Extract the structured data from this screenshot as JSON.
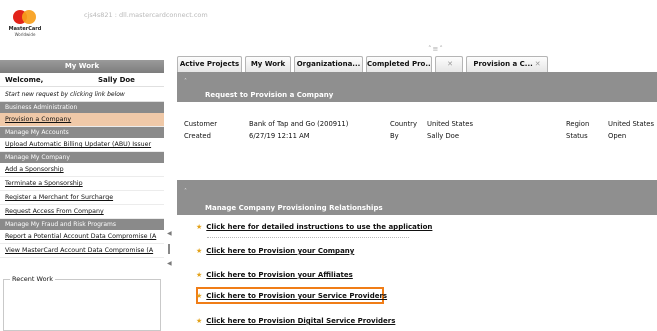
{
  "header": {
    "logo_text": "MasterCard",
    "logo_sub": "Worldwide",
    "host": "cjs4s821 : dll.mastercardconnect.com"
  },
  "sidebar": {
    "title": "My Work",
    "welcome_label": "Welcome,",
    "user_name": "Sally Doe",
    "hint": "Start new request by clicking link below",
    "sections": [
      {
        "title": "Business Administration",
        "items": [
          "Provision a Company"
        ]
      },
      {
        "title": "Manage My Accounts",
        "items": [
          "Upload Automatic Billing Updater (ABU) Issuer"
        ]
      },
      {
        "title": "Manage My Company",
        "items": [
          "Add a Sponsorship",
          "Terminate a Sponsorship",
          "Register a Merchant for Surcharge",
          "Request Access From Company"
        ]
      },
      {
        "title": "Manage My Fraud and Risk Programs",
        "items": [
          "Report a Potential Account Data Compromise (A",
          "View MasterCard Account Data Compromise (A"
        ]
      }
    ],
    "recent_work_label": "Recent Work",
    "selected_item": "Provision a Company"
  },
  "tabs": [
    {
      "label": "Active Projects",
      "closable": false
    },
    {
      "label": "My Work",
      "closable": false
    },
    {
      "label": "Organizationa...",
      "closable": false
    },
    {
      "label": "Completed Pro...",
      "closable": false
    },
    {
      "label": "",
      "closable": true
    },
    {
      "label": "Provision a C...",
      "closable": true,
      "active": true
    }
  ],
  "request": {
    "section_title": "Request to Provision a Company",
    "customer_label": "Customer",
    "customer_value": "Bank of Tap and Go (200911)",
    "country_label": "Country",
    "country_value": "United States",
    "region_label": "Region",
    "region_value": "United States",
    "created_label": "Created",
    "created_value": "6/27/19 12:11 AM",
    "by_label": "By",
    "by_value": "Sally Doe",
    "status_label": "Status",
    "status_value": "Open"
  },
  "relationships": {
    "section_title": "Manage Company Provisioning Relationships",
    "links": [
      "Click here for detailed instructions to use the application",
      "Click here to Provision your Company",
      "Click here to Provision your Affiliates",
      "Click here to Provision your Service Providers",
      "Click here to Provision Digital Service Providers"
    ],
    "highlighted_link": "Click here to Provision your Service Providers",
    "highlight_color": "#f07d17",
    "star_color": "#e3a21a"
  },
  "colors": {
    "section_header": "#8a8a8a",
    "selected_item": "#f0c9a8",
    "band": "#8f8f8f"
  }
}
